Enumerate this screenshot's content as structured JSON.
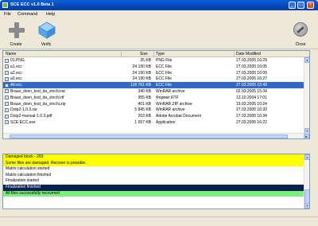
{
  "window": {
    "title": "SCE ECC v1.0 Beta 1",
    "icon": "app-icon",
    "controls": [
      "_",
      "□",
      "×"
    ]
  },
  "menu": [
    "File",
    "Command",
    "Help"
  ],
  "toolbar": {
    "create_label": "Create",
    "verify_label": "Verify",
    "close_label": "Close"
  },
  "filelist": {
    "columns": [
      "Name",
      "Size",
      "Type",
      "Date Modified"
    ],
    "rows": [
      {
        "name": "01.PNG",
        "size": "35 KB",
        "type": "PNG File",
        "date": "27.03.2005 16:29"
      },
      {
        "name": "a1.ecc",
        "size": "24 190 KB",
        "type": "ECC File",
        "date": "27.03.2005 16:05"
      },
      {
        "name": "a2.ecc",
        "size": "24 190 KB",
        "type": "ECC File",
        "date": "27.03.2005 16:09"
      },
      {
        "name": "a3.ecc",
        "size": "24 190 KB",
        "type": "ECC File",
        "date": "27.03.2005 16:27"
      },
      {
        "name": "All.ecc",
        "size": "118 761 KB",
        "type": "ECC File",
        "date": "27.03.2005 15:49",
        "selected": true
      },
      {
        "name": "Braun_dven_kod_da_vinchi.rar",
        "size": "340 KB",
        "type": "WinRAR archive",
        "date": "02.03.2005 15:34"
      },
      {
        "name": "Braun_dven_kod_da_vinchi.rtf",
        "size": "955 KB",
        "type": "Формат RTF",
        "date": "13.10.2004 17:01"
      },
      {
        "name": "Braun_dven_kod_da_vinchi.zip",
        "size": "401 KB",
        "type": "WinRAR ZIP archive",
        "date": "19.03.2005 10:24"
      },
      {
        "name": "Dotp2-1.0.3.rar",
        "size": "5 845 KB",
        "type": "WinRAR archive",
        "date": "27.03.2005 16:33"
      },
      {
        "name": "Dotp2-manual-1.0.3.pdf",
        "size": "203 KB",
        "type": "Adobe Acrobat Document",
        "date": "27.03.2005 16:34"
      },
      {
        "name": "SCE ECC.exe",
        "size": "1 657 KB",
        "type": "Application",
        "date": "27.03.2005 16:22"
      }
    ]
  },
  "log": [
    {
      "text": "Damaged block - 283",
      "style": "yellow"
    },
    {
      "text": "Some files are damaged. Recover is possible.",
      "style": "yellow"
    },
    {
      "text": "Matrix calculation started",
      "style": "plain"
    },
    {
      "text": "Matrix calculation finished",
      "style": "plain"
    },
    {
      "text": "Finalization started",
      "style": "plain"
    },
    {
      "text": "Finalization finished",
      "style": "dark"
    },
    {
      "text": "All files successfully recovered",
      "style": "green"
    }
  ],
  "colors": {
    "selection": "#316ac5",
    "log_yellow": "#ffff00",
    "log_dark": "#0a2050",
    "log_green": "#7cf07c"
  }
}
